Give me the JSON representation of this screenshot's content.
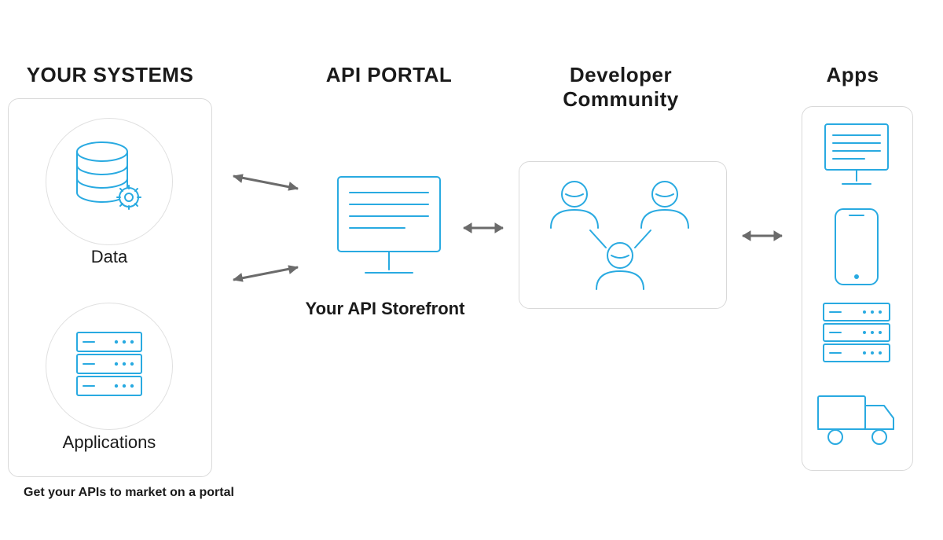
{
  "headings": {
    "systems": "YOUR SYSTEMS",
    "portal": "API PORTAL",
    "developer": "Developer\nCommunity",
    "apps": "Apps"
  },
  "labels": {
    "data": "Data",
    "applications": "Applications",
    "storefront": "Your API Storefront"
  },
  "caption": "Get your APIs to market on a portal",
  "icons": {
    "data": "database-gear-icon",
    "applications": "server-icon",
    "portal": "monitor-screen-icon",
    "developer": "people-group-icon",
    "app1": "monitor-screen-icon",
    "app2": "smartphone-icon",
    "app3": "server-icon",
    "app4": "truck-icon"
  },
  "arrows": [
    "systems-data-to-portal",
    "systems-apps-to-portal",
    "portal-to-developer",
    "developer-to-apps"
  ]
}
